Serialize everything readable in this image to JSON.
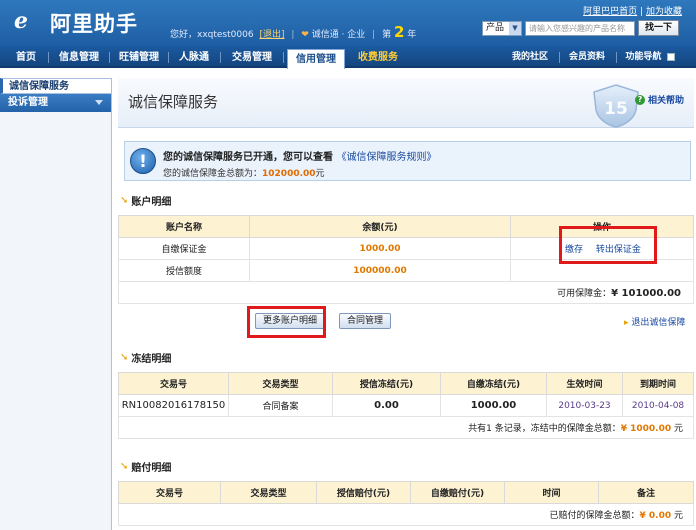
{
  "header": {
    "app_title": "阿里助手",
    "greeting": "您好，xxqtest0006",
    "logout": "[退出]",
    "trust_label": "诚信通 · 企业",
    "year_prefix": "第",
    "year_num": "2",
    "year_suffix": "年",
    "link_home": "阿里巴巴首页",
    "link_fav": "加为收藏",
    "search_select": "产品",
    "search_placeholder": "请输入您感兴趣的产品名称",
    "search_button": "找一下"
  },
  "nav": {
    "items": [
      "首页",
      "信息管理",
      "旺铺管理",
      "人脉通",
      "交易管理",
      "信用管理",
      "收费服务"
    ],
    "active": "信用管理",
    "right_items": [
      "我的社区",
      "会员资料",
      "功能导航"
    ]
  },
  "sidebar": {
    "item1": "诚信保障服务",
    "item2": "投诉管理"
  },
  "page": {
    "title": "诚信保障服务",
    "help": "相关帮助",
    "notice_main": "您的诚信保障服务已开通，您可以查看",
    "notice_link": "《诚信保障服务规则》",
    "notice_sub_prefix": "您的诚信保障金总额为：",
    "notice_sub_amount": "102000.00",
    "notice_sub_suffix": "元"
  },
  "account": {
    "section_title": "账户明细",
    "headers": [
      "账户名称",
      "余额(元)",
      "操作"
    ],
    "rows": [
      {
        "name": "自缴保证金",
        "balance": "1000.00",
        "op1": "缴存",
        "op2": "转出保证金"
      },
      {
        "name": "授信额度",
        "balance": "100000.00"
      }
    ],
    "available_label": "可用保障金：",
    "available_value": "¥ 101000.00",
    "btn_more": "更多账户明细",
    "btn_contract": "合同管理",
    "exit_link": "退出诚信保障"
  },
  "frozen": {
    "section_title": "冻结明细",
    "headers": [
      "交易号",
      "交易类型",
      "授信冻结(元)",
      "自缴冻结(元)",
      "生效时间",
      "到期时间"
    ],
    "rows": [
      [
        "RN10082016178150",
        "合同备案",
        "0.00",
        "1000.00",
        "2010-03-23",
        "2010-04-08"
      ]
    ],
    "summary_prefix": "共有1 条记录，冻结中的保障金总额：",
    "summary_value": "¥ 1000.00",
    "summary_suffix": "元"
  },
  "payout": {
    "section_title": "赔付明细",
    "headers": [
      "交易号",
      "交易类型",
      "授信赔付(元)",
      "自缴赔付(元)",
      "时间",
      "备注"
    ],
    "summary_prefix": "已赔付的保障金总额：",
    "summary_value": "¥ 0.00",
    "summary_suffix": "元"
  }
}
